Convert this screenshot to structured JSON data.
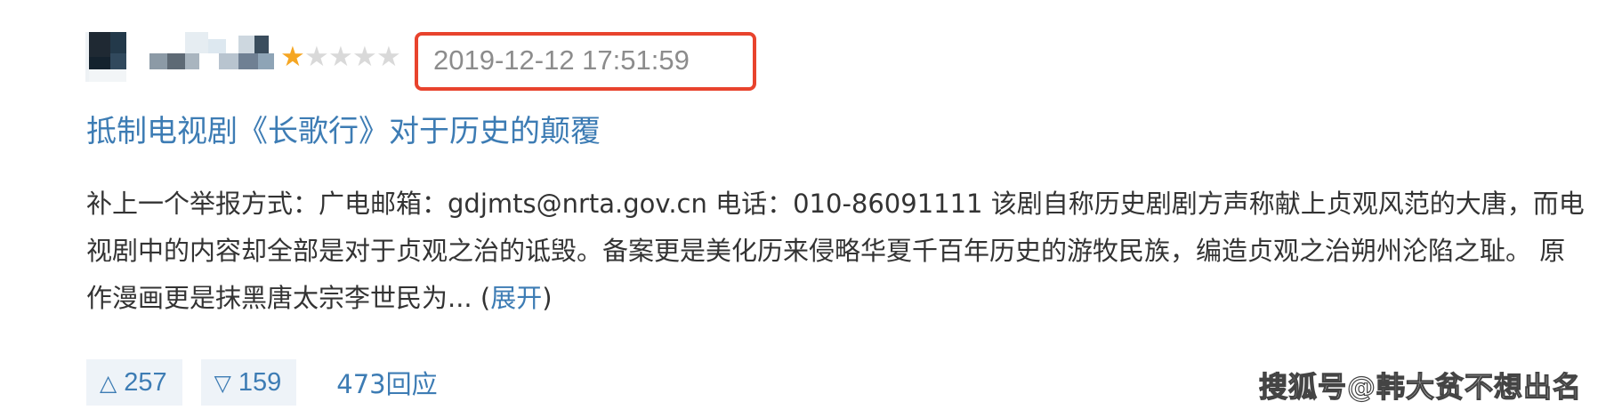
{
  "review": {
    "rating": 1,
    "rating_max": 5,
    "timestamp": "2019-12-12 17:51:59",
    "title": "抵制电视剧《长歌行》对于历史的颠覆",
    "body": "补上一个举报方式：广电邮箱：gdjmts@nrta.gov.cn 电话：010-86091111 该剧自称历史剧剧方声称献上贞观风范的大唐，而电视剧中的内容却全部是对于贞观之治的诋毁。备案更是美化历来侵略华夏千百年历史的游牧民族，编造贞观之治朔州沦陷之耻。 原作漫画更是抹黑唐太宗李世民为... ",
    "expand_label": "展开",
    "paren_open": "(",
    "paren_close": ")"
  },
  "actions": {
    "upvote_icon": "triangle-up-icon",
    "upvote_count": "257",
    "downvote_icon": "triangle-down-icon",
    "downvote_count": "159",
    "replies_label": "473回应"
  },
  "watermark": "搜狐号@韩大贫不想出名",
  "colors": {
    "link": "#3d7cb4",
    "star_on": "#f5a623",
    "star_off": "#d9d9d9",
    "highlight_box": "#e8432d",
    "vote_bg": "#eef3f8"
  }
}
